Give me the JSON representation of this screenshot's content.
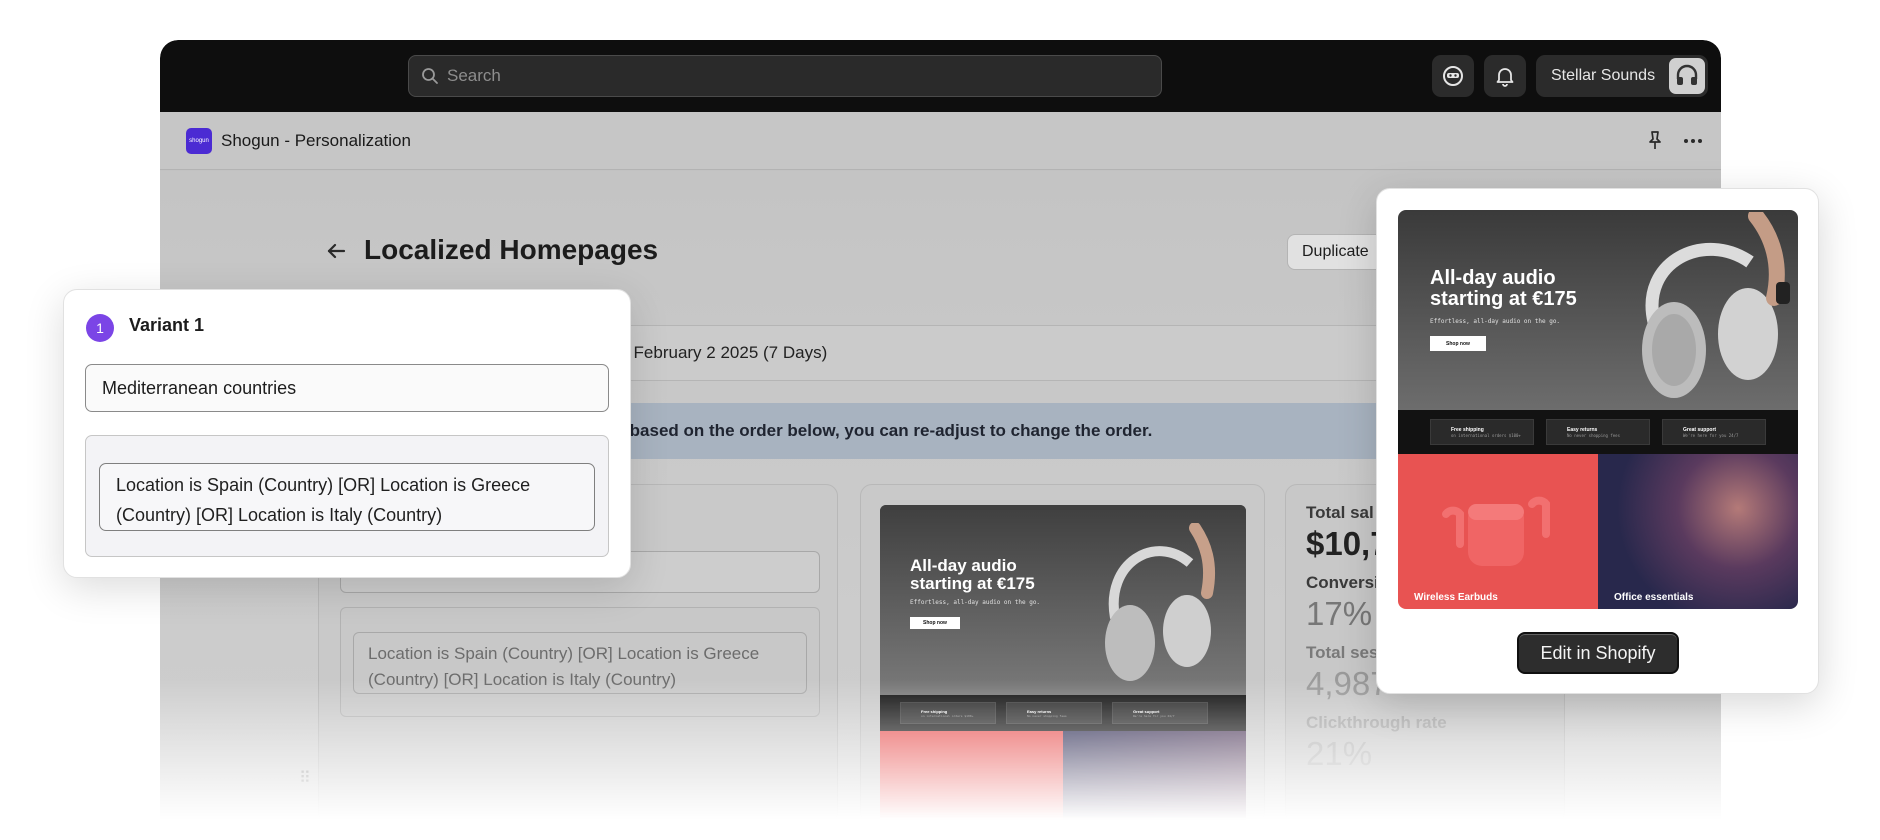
{
  "topbar": {
    "search_placeholder": "Search",
    "store_name": "Stellar Sounds",
    "icons": [
      "agent-icon",
      "bell-icon",
      "headphones-avatar-icon"
    ]
  },
  "appbar": {
    "logo_text": "shogun",
    "title": "Shogun - Personalization"
  },
  "page": {
    "title": "Localized Homepages",
    "duplicate_label": "Duplicate",
    "date_range_text": "25 to February 2 2025 (7 Days)",
    "info_text": "ants based on the order below, you can re-adjust to change the order."
  },
  "variant": {
    "number": "1",
    "title": "Variant 1",
    "name_value": "Mediterranean countries",
    "condition": "Location is Spain (Country) [OR] Location is Greece (Country) [OR] Location is Italy (Country)"
  },
  "stats": {
    "total_sales_label": "Total sal",
    "total_sales_value": "$10,7",
    "conversion_label": "Conversi",
    "conversion_value": "17%",
    "sessions_label": "Total ses",
    "sessions_value": "4,987",
    "ctr_label": "Clickthrough rate",
    "ctr_value": "21%"
  },
  "store_preview": {
    "headline_line1": "All-day audio",
    "headline_line2": "starting at €175",
    "subtext": "Effortless, all-day audio on the go.",
    "cta": "Shop now",
    "features": [
      {
        "title": "Free shipping",
        "desc": "on international orders $100+"
      },
      {
        "title": "Easy returns",
        "desc": "No never shopping fees"
      },
      {
        "title": "Great support",
        "desc": "We're here for you 24/7"
      }
    ],
    "tile_left": "Wireless Earbuds",
    "tile_right": "Office essentials"
  },
  "shopify_panel": {
    "edit_label": "Edit in Shopify"
  },
  "colors": {
    "accent_purple": "#7b45e6",
    "shogun_logo": "#4b2bd3",
    "topbar_bg": "#0e0e0e",
    "earbuds_red": "#e85352",
    "office_purple": "#3a3a6a"
  }
}
